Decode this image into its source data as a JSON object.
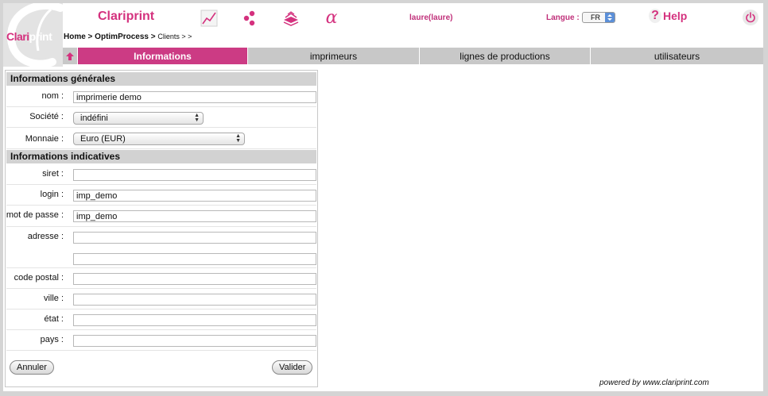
{
  "logo": {
    "part1": "Clari",
    "part2": "print"
  },
  "header": {
    "app_title": "Clariprint",
    "user": "laure(laure)",
    "langue_label": "Langue :",
    "lang_value": "FR",
    "help_symbol": "?",
    "help_label": "Help"
  },
  "icons": [
    "chart-icon",
    "process-icon",
    "paper-stack-icon",
    "alpha-icon",
    "power-icon"
  ],
  "breadcrumb": {
    "main": "Home > OptimProcess > ",
    "sub": "Clients > >"
  },
  "tabs": [
    {
      "label": "Informations",
      "active": true
    },
    {
      "label": "imprimeurs",
      "active": false
    },
    {
      "label": "lignes de productions",
      "active": false
    },
    {
      "label": "utilisateurs",
      "active": false
    }
  ],
  "form": {
    "section_general": "Informations générales",
    "nom_label": "nom :",
    "nom_value": "imprimerie demo",
    "societe_label": "Société :",
    "societe_value": "indéfini",
    "monnaie_label": "Monnaie :",
    "monnaie_value": "Euro (EUR)",
    "section_indicative": "Informations indicatives",
    "siret_label": "siret :",
    "siret_value": "",
    "login_label": "login :",
    "login_value": "imp_demo",
    "password_label": "mot de passe :",
    "password_value": "imp_demo",
    "adresse_label": "adresse :",
    "adresse_value": "",
    "adresse2_value": "",
    "code_postal_label": "code postal :",
    "code_postal_value": "",
    "ville_label": "ville :",
    "ville_value": "",
    "etat_label": "état :",
    "etat_value": "",
    "pays_label": "pays :",
    "pays_value": "",
    "cancel_label": "Annuler",
    "submit_label": "Valider"
  },
  "footer": {
    "powered": "powered by www.clariprint.com"
  },
  "colors": {
    "accent": "#d4317e",
    "tab_active": "#cc3b84",
    "tab_bg": "#c8c8c8",
    "section_bg": "#d2d2d2"
  }
}
